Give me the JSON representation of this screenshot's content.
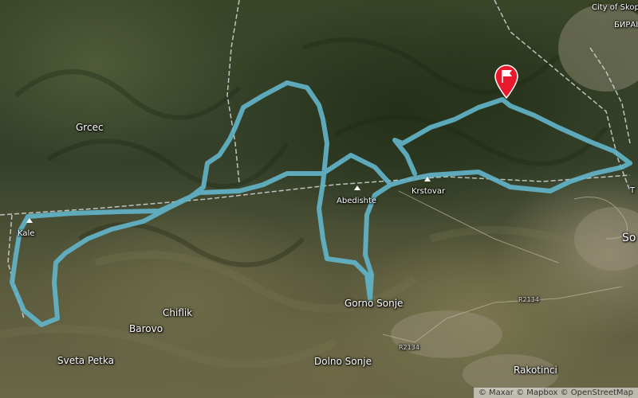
{
  "route": {
    "color": "#62b3c8"
  },
  "places": {
    "city_of_skopje": "City of Skop",
    "birar": "БИРАІ",
    "grcec": "Grcec",
    "kale": "Kale",
    "abedishte": "Abedishte",
    "krstovar": "Krstovar",
    "gorno_sonje": "Gorno Sonje",
    "chiflik": "Chiflik",
    "barovo": "Barovo",
    "sveta_petka": "Sveta Petka",
    "dolno_sonje": "Dolno Sonje",
    "rakotinci": "Rakotinci",
    "so": "So",
    "t_edge": "T"
  },
  "roads": {
    "r2134_a": "R2134",
    "r2134_b": "R2134"
  },
  "marker": {
    "icon": "flag-icon",
    "color": "#e8192c"
  },
  "attribution": "© Maxar © Mapbox © OpenStreetMap"
}
